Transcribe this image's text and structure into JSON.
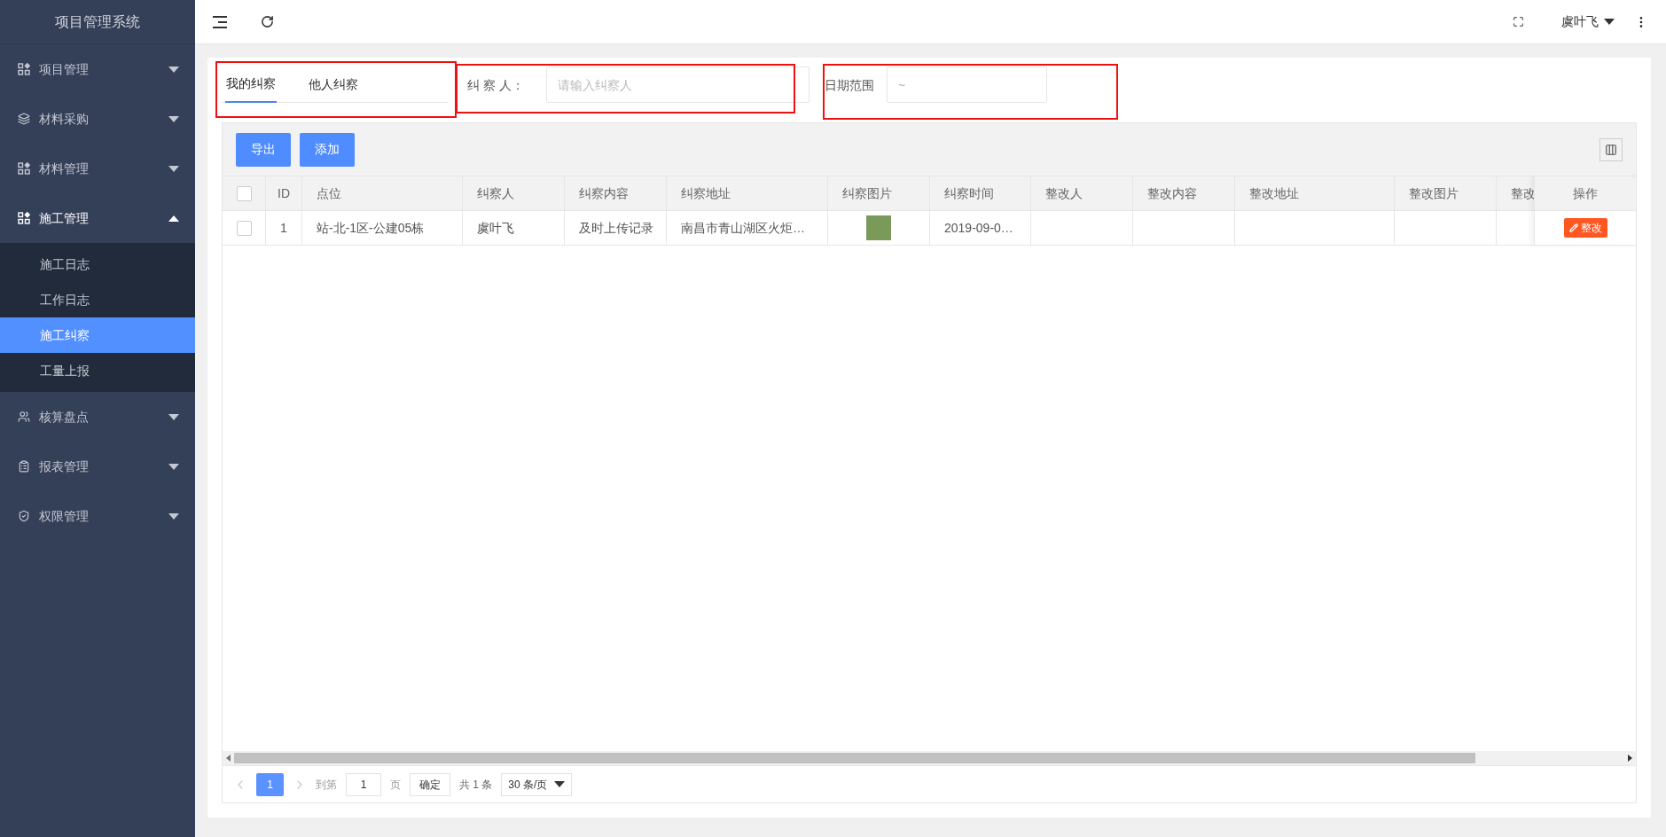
{
  "sidebar": {
    "title": "项目管理系统",
    "items": [
      {
        "label": "项目管理",
        "expanded": false
      },
      {
        "label": "材料采购",
        "expanded": false
      },
      {
        "label": "材料管理",
        "expanded": false
      },
      {
        "label": "施工管理",
        "expanded": true,
        "children": [
          {
            "label": "施工日志",
            "selected": false
          },
          {
            "label": "工作日志",
            "selected": false
          },
          {
            "label": "施工纠察",
            "selected": true
          },
          {
            "label": "工量上报",
            "selected": false
          }
        ]
      },
      {
        "label": "核算盘点",
        "expanded": false
      },
      {
        "label": "报表管理",
        "expanded": false
      },
      {
        "label": "权限管理",
        "expanded": false
      }
    ]
  },
  "header": {
    "user": "虞叶飞"
  },
  "filters": {
    "tabs": [
      {
        "label": "我的纠察",
        "selected": true
      },
      {
        "label": "他人纠察",
        "selected": false
      }
    ],
    "fields": [
      {
        "label": "纠 察 人：",
        "placeholder": "请输入纠察人"
      },
      {
        "label": "日期范围",
        "placeholder": "~"
      }
    ]
  },
  "toolbar": {
    "buttons": [
      "导出",
      "添加"
    ]
  },
  "table": {
    "columns": [
      "ID",
      "点位",
      "纠察人",
      "纠察内容",
      "纠察地址",
      "纠察图片",
      "纠察时间",
      "整改人",
      "整改内容",
      "整改地址",
      "整改图片",
      "整改"
    ],
    "action_column": "操作",
    "all_checked": false,
    "rows": [
      {
        "checked": false,
        "cells": [
          {
            "text": "1"
          },
          {
            "text": "站-北-1区-公建05栋"
          },
          {
            "text": "虞叶飞"
          },
          {
            "text": "及时上传记录"
          },
          {
            "text": "南昌市青山湖区火炬…"
          },
          {
            "kind": "photo"
          },
          {
            "text": "2019-09-0…"
          },
          null,
          null,
          null,
          null,
          null
        ],
        "action": "整改"
      }
    ]
  },
  "pagination": {
    "pages": [
      {
        "label": "1",
        "selected": true
      }
    ],
    "goto_label": "到第",
    "goto_value": "1",
    "page_unit": "页",
    "confirm": "确定",
    "total": "共 1 条",
    "page_size": "30 条/页"
  }
}
